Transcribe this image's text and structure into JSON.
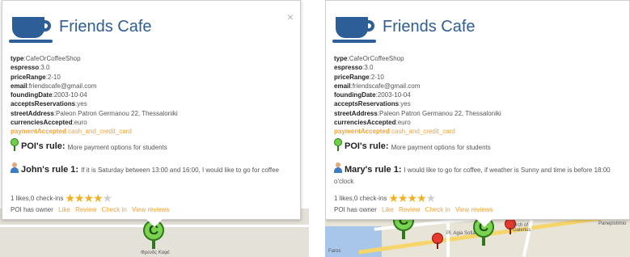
{
  "popups": [
    {
      "title": "Friends Cafe",
      "close_glyph": "×",
      "props": [
        {
          "key": "type",
          "value": "CafeOrCoffeeShop"
        },
        {
          "key": "espresso",
          "value": "3.0"
        },
        {
          "key": "priceRange",
          "value": "2-10"
        },
        {
          "key": "email",
          "value": "friendscafe@gmail.com"
        },
        {
          "key": "foundingDate",
          "value": "2003-10-04"
        },
        {
          "key": "acceptsReservations",
          "value": "yes"
        },
        {
          "key": "streetAddress",
          "value": "Paleon Patron Germanou 22, Thessaloniki"
        },
        {
          "key": "currenciesAccepted",
          "value": "euro"
        },
        {
          "key": "paymentAccepted",
          "value": "cash_and_credit_card"
        }
      ],
      "poi_rule": {
        "title": "POI's rule:",
        "text": "More payment options for students"
      },
      "user_rule": {
        "title": "John's rule 1:",
        "text": "If it is Saturday between 13:00 and 16:00, I would like to go for coffee"
      },
      "likes_text": "1 likes,0 check-ins",
      "rating": 4,
      "rating_max": 5,
      "owner_text": "POI has owner",
      "actions": [
        "Like",
        "Review",
        "Check in",
        "View reviews"
      ],
      "map_labels": {
        "place": "Φρενδς Καφέ"
      }
    },
    {
      "title": "Friends Cafe",
      "props": [
        {
          "key": "type",
          "value": "CafeOrCoffeeShop"
        },
        {
          "key": "espresso",
          "value": "3.0"
        },
        {
          "key": "priceRange",
          "value": "2-10"
        },
        {
          "key": "email",
          "value": "friendscafe@gmail.com"
        },
        {
          "key": "foundingDate",
          "value": "2003-10-04"
        },
        {
          "key": "acceptsReservations",
          "value": "yes"
        },
        {
          "key": "streetAddress",
          "value": "Paleon Patron Germanou 22, Thessaloniki"
        },
        {
          "key": "currenciesAccepted",
          "value": "euro"
        },
        {
          "key": "paymentAccepted",
          "value": "cash_and_credit_card"
        }
      ],
      "poi_rule": {
        "title": "POI's rule:",
        "text": "More payment options for students"
      },
      "user_rule": {
        "title": "Mary's rule 1:",
        "text": "I would like to go for coffee, if weather is Sunny and time is before 18:00 o'clock"
      },
      "likes_text": "1 likes,0 check-ins",
      "rating": 4,
      "rating_max": 5,
      "owner_text": "POI has owner",
      "actions": [
        "Like",
        "Review",
        "Check in",
        "View reviews"
      ],
      "map_labels": {
        "faros": "Faros",
        "square": "Pl. Agia Sofia",
        "arch": "Arch of Galerius",
        "aristotle": "Aristotle Panepistimio"
      }
    }
  ],
  "pin_letter": "C",
  "colors": {
    "title": "#2e5e98",
    "accent": "#f0a33a",
    "pin_green": "#7bd24e",
    "pin_red": "#e63a2e"
  }
}
